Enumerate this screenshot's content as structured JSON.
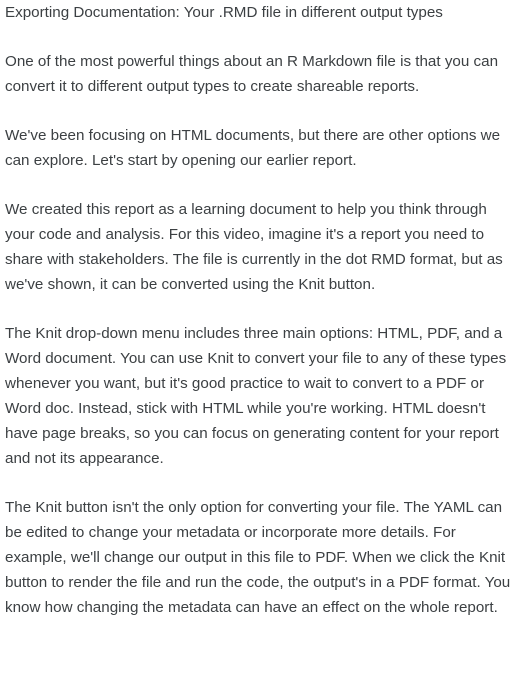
{
  "document": {
    "title": "Exporting Documentation: Your .RMD file in different output types",
    "paragraphs": [
      "One of the most powerful things about an R Markdown file is that you can convert it to different output types to create shareable reports.",
      "We've been focusing on HTML documents, but there are other options we can explore. Let's start by opening our earlier report.",
      "We created this report as a learning document to help you think through your code and analysis. For this video, imagine it's a report you need to share with stakeholders. The file is currently in the dot RMD format, but as we've shown, it can be converted using the Knit button.",
      "The Knit drop-down menu includes three main options: HTML, PDF, and a Word document. You can use Knit to convert your file to any of these types whenever you want, but it's good practice to wait to convert to a PDF or Word doc. Instead, stick with HTML while you're working. HTML doesn't have page breaks, so you can focus on generating content for your report and not its appearance.",
      "The Knit button isn't the only option for converting your file. The YAML can be edited to change your metadata or incorporate more details. For example, we'll change our output in this file to PDF. When we click the Knit button to render the file and run the code, the output's in a PDF format. You know how changing the metadata can have an effect on the whole report."
    ]
  }
}
